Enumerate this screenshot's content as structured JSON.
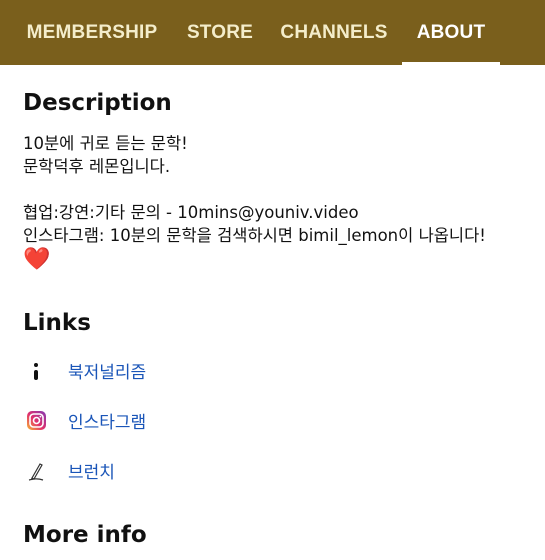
{
  "tabs": [
    {
      "label": "MEMBERSHIP",
      "active": false
    },
    {
      "label": "STORE",
      "active": false
    },
    {
      "label": "CHANNELS",
      "active": false
    },
    {
      "label": "ABOUT",
      "active": true
    }
  ],
  "description": {
    "heading": "Description",
    "lines": [
      "10분에 귀로 듣는 문학!",
      "문학덕후 레몬입니다.",
      "",
      "협업:강연:기타 문의 - 10mins@youniv.video",
      "인스타그램: 10분의 문학을 검색하시면 bimil_lemon이 나옵니다!"
    ],
    "emoji": "❤️"
  },
  "links": {
    "heading": "Links",
    "items": [
      {
        "label": "북저널리즘",
        "icon": "more-vert-icon"
      },
      {
        "label": "인스타그램",
        "icon": "instagram-icon"
      },
      {
        "label": "브런치",
        "icon": "brunch-pen-icon"
      }
    ]
  },
  "more_info": {
    "heading": "More info"
  },
  "colors": {
    "topbar": "#7a5f1c",
    "tab_text": "#f4edcb",
    "link": "#1a55b8"
  }
}
